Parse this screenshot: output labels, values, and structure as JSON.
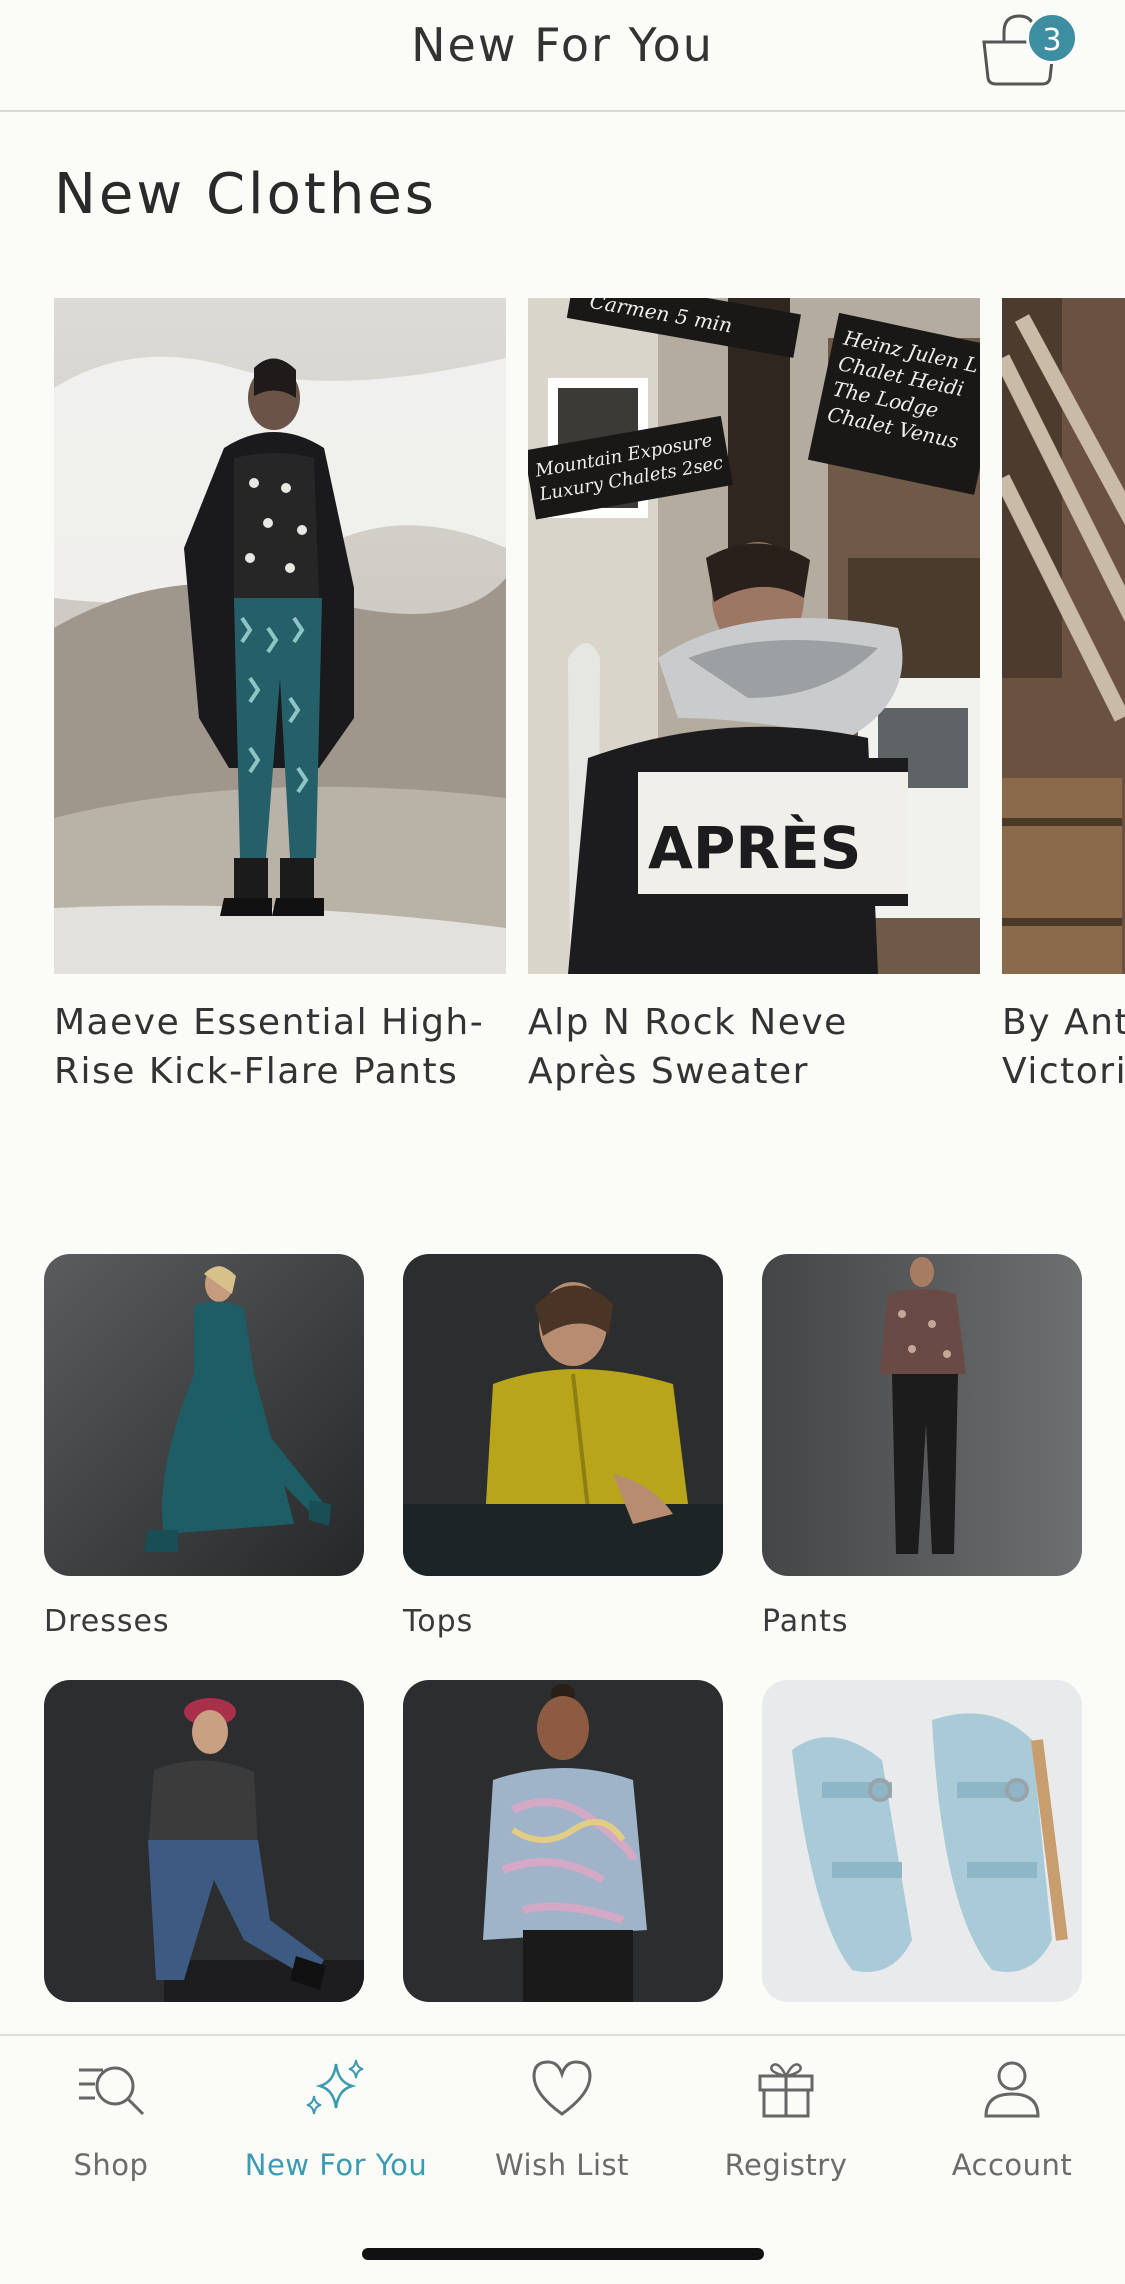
{
  "header": {
    "title": "New For You",
    "cart_count": "3"
  },
  "section": {
    "title": "New Clothes"
  },
  "products": [
    {
      "name": "Maeve Essential High-\nRise Kick-Flare Pants"
    },
    {
      "name": "Alp N Rock Neve\nAprès Sweater"
    },
    {
      "name": "By Anth\nVictoria"
    }
  ],
  "categories": [
    {
      "label": "Dresses"
    },
    {
      "label": "Tops"
    },
    {
      "label": "Pants"
    },
    {
      "label": ""
    },
    {
      "label": ""
    },
    {
      "label": ""
    }
  ],
  "photo_text": {
    "sign_top": "Carmen   5 min",
    "sign_right": "Heinz Julen L\nChalet Heidi\nThe Lodge\nChalet Venus",
    "sign_left": "Mountain Exposure\nLuxury Chalets 2sec",
    "sweater": "APRÈS"
  },
  "tabs": [
    {
      "label": "Shop",
      "icon": "search-list-icon"
    },
    {
      "label": "New For You",
      "icon": "sparkles-icon",
      "active": true
    },
    {
      "label": "Wish List",
      "icon": "heart-icon"
    },
    {
      "label": "Registry",
      "icon": "gift-icon"
    },
    {
      "label": "Account",
      "icon": "person-icon"
    }
  ],
  "colors": {
    "accent": "#3a9bb1",
    "badge": "#3d8ea0",
    "background": "#fbfbf8"
  }
}
